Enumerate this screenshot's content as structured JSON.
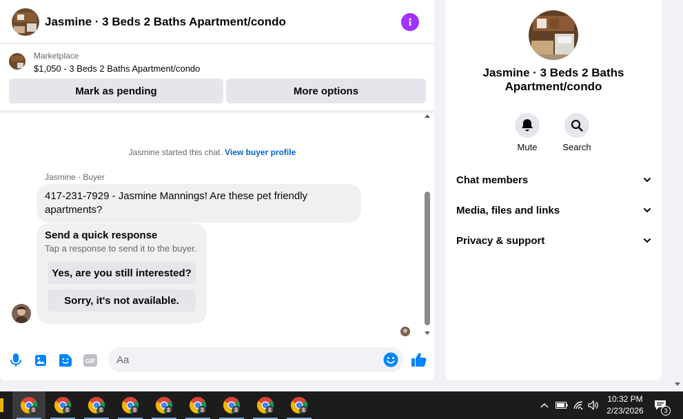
{
  "header": {
    "title": "Jasmine · 3 Beds 2 Baths Apartment/condo",
    "info_icon": "info-icon",
    "accent_color": "#a033ff"
  },
  "listing": {
    "label": "Marketplace",
    "price_line": "$1,050 - 3 Beds 2 Baths Apartment/condo"
  },
  "actions": {
    "mark_pending": "Mark as pending",
    "more_options": "More options"
  },
  "thread": {
    "system_text": "Jasmine started this chat.",
    "system_link": "View buyer profile",
    "sender_label": "Jasmine · Buyer",
    "message": "417-231-7929 - Jasmine Mannings! Are these pet friendly apartments?",
    "quick_response": {
      "title": "Send a quick response",
      "subtitle": "Tap a response to send it to the buyer.",
      "options": [
        "Yes, are you still interested?",
        "Sorry, it's not available."
      ]
    }
  },
  "composer": {
    "placeholder": "Aa",
    "icons": [
      "microphone-icon",
      "photo-icon",
      "sticker-icon",
      "gif-icon",
      "emoji-icon",
      "thumbs-up-icon"
    ],
    "gif_label": "GIF",
    "accent_color": "#0084ff"
  },
  "info_panel": {
    "title": "Jasmine · 3 Beds 2 Baths Apartment/condo",
    "actions": [
      {
        "label": "Mute",
        "icon": "bell-icon"
      },
      {
        "label": "Search",
        "icon": "search-icon"
      }
    ],
    "sections": [
      "Chat members",
      "Media, files and links",
      "Privacy & support"
    ]
  },
  "taskbar": {
    "time": "10:32 PM",
    "date": "2/23/2026",
    "notification_count": "3",
    "app_count": 9
  }
}
